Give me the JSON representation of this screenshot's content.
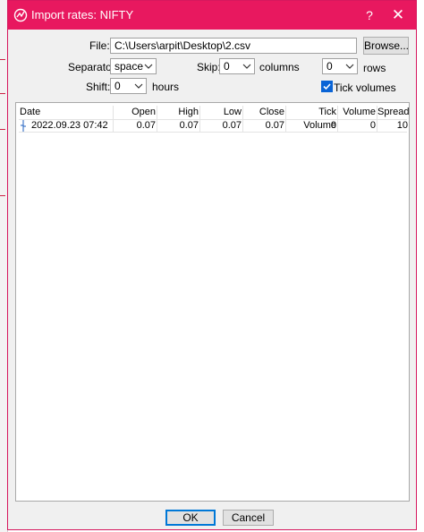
{
  "window": {
    "title": "Import rates: NIFTY",
    "help_label": "?",
    "close_label": "✕"
  },
  "form": {
    "file_label": "File:",
    "file_value": "C:\\Users\\arpit\\Desktop\\2.csv",
    "browse_label": "Browse...",
    "separator_label": "Separator:",
    "separator_value": "space",
    "skip_label": "Skip:",
    "skip_columns_value": "0",
    "columns_label": "columns",
    "skip_rows_value": "0",
    "rows_label": "rows",
    "shift_label": "Shift:",
    "shift_value": "0",
    "hours_label": "hours",
    "tick_volumes_label": "Tick volumes",
    "tick_volumes_checked": true
  },
  "table": {
    "columns": [
      "Date",
      "Open",
      "High",
      "Low",
      "Close",
      "Tick Volume",
      "Volume",
      "Spread"
    ],
    "rows": [
      [
        "2022.09.23 07:42",
        "0.07",
        "0.07",
        "0.07",
        "0.07",
        "0",
        "0",
        "10"
      ]
    ]
  },
  "footer": {
    "ok_label": "OK",
    "cancel_label": "Cancel"
  },
  "colors": {
    "titlebar": "#e8185f",
    "accent": "#0a64d6"
  }
}
